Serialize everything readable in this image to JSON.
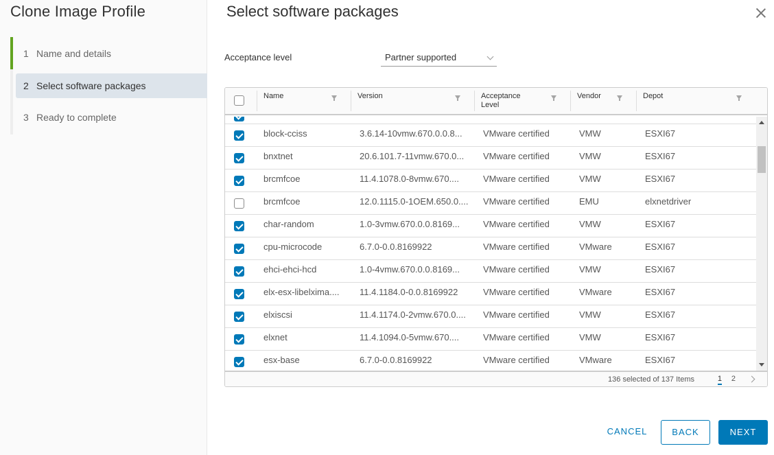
{
  "wizard": {
    "title": "Clone Image Profile",
    "steps": [
      {
        "num": "1",
        "label": "Name and details",
        "state": "completed"
      },
      {
        "num": "2",
        "label": "Select software packages",
        "state": "active"
      },
      {
        "num": "3",
        "label": "Ready to complete",
        "state": "pending"
      }
    ],
    "progress_color": "#62a420"
  },
  "page": {
    "title": "Select software packages",
    "acceptance_level_label": "Acceptance level",
    "acceptance_level_value": "Partner supported"
  },
  "grid": {
    "columns": [
      "Name",
      "Version",
      "Acceptance Level",
      "Vendor",
      "Depot"
    ],
    "rows": [
      {
        "checked": true,
        "name": "block-cciss",
        "version": "3.6.14-10vmw.670.0.0.8...",
        "acceptance": "VMware certified",
        "vendor": "VMW",
        "depot": "ESXI67"
      },
      {
        "checked": true,
        "name": "bnxtnet",
        "version": "20.6.101.7-11vmw.670.0...",
        "acceptance": "VMware certified",
        "vendor": "VMW",
        "depot": "ESXI67"
      },
      {
        "checked": true,
        "name": "brcmfcoe",
        "version": "11.4.1078.0-8vmw.670....",
        "acceptance": "VMware certified",
        "vendor": "VMW",
        "depot": "ESXI67"
      },
      {
        "checked": false,
        "name": "brcmfcoe",
        "version": "12.0.1115.0-1OEM.650.0....",
        "acceptance": "VMware certified",
        "vendor": "EMU",
        "depot": "elxnetdriver"
      },
      {
        "checked": true,
        "name": "char-random",
        "version": "1.0-3vmw.670.0.0.8169...",
        "acceptance": "VMware certified",
        "vendor": "VMW",
        "depot": "ESXI67"
      },
      {
        "checked": true,
        "name": "cpu-microcode",
        "version": "6.7.0-0.0.8169922",
        "acceptance": "VMware certified",
        "vendor": "VMware",
        "depot": "ESXI67"
      },
      {
        "checked": true,
        "name": "ehci-ehci-hcd",
        "version": "1.0-4vmw.670.0.0.8169...",
        "acceptance": "VMware certified",
        "vendor": "VMW",
        "depot": "ESXI67"
      },
      {
        "checked": true,
        "name": "elx-esx-libelxima....",
        "version": "11.4.1184.0-0.0.8169922",
        "acceptance": "VMware certified",
        "vendor": "VMware",
        "depot": "ESXI67"
      },
      {
        "checked": true,
        "name": "elxiscsi",
        "version": "11.4.1174.0-2vmw.670.0....",
        "acceptance": "VMware certified",
        "vendor": "VMW",
        "depot": "ESXI67"
      },
      {
        "checked": true,
        "name": "elxnet",
        "version": "11.4.1094.0-5vmw.670....",
        "acceptance": "VMware certified",
        "vendor": "VMW",
        "depot": "ESXI67"
      },
      {
        "checked": true,
        "name": "esx-base",
        "version": "6.7.0-0.0.8169922",
        "acceptance": "VMware certified",
        "vendor": "VMware",
        "depot": "ESXI67"
      }
    ],
    "footer": {
      "count_text": "136 selected of 137 Items",
      "pages": [
        "1",
        "2"
      ],
      "current_page": "1"
    }
  },
  "buttons": {
    "cancel": "CANCEL",
    "back": "BACK",
    "next": "NEXT"
  },
  "colors": {
    "accent": "#0079b8",
    "active_step_bg": "#dde4eb"
  }
}
